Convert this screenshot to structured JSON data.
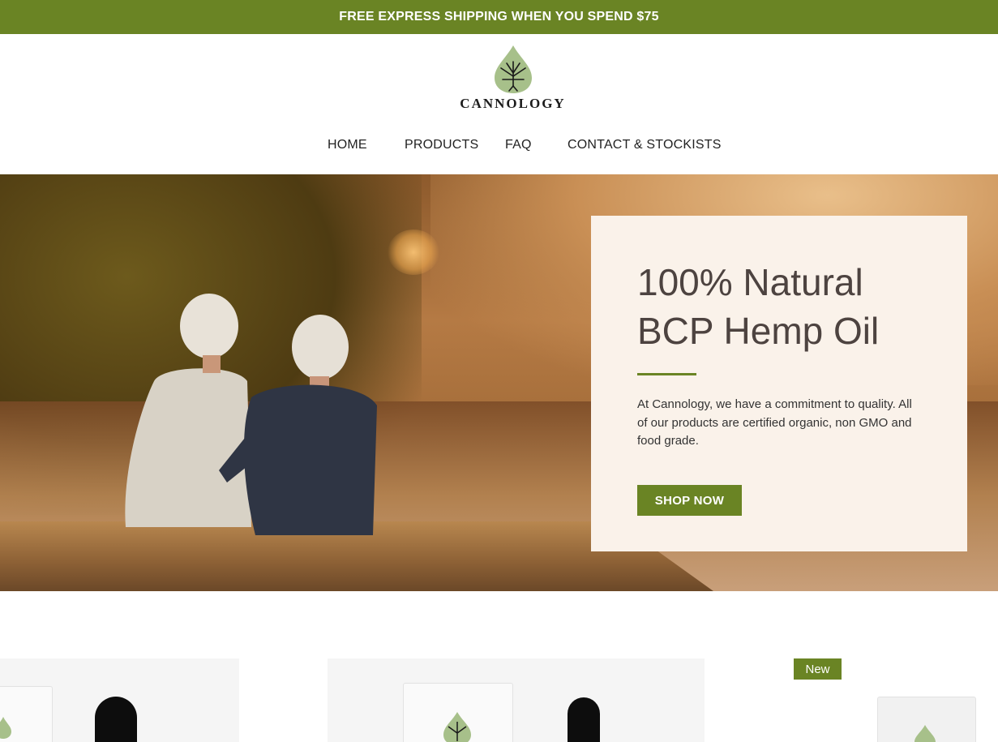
{
  "promo": {
    "text": "FREE EXPRESS SHIPPING WHEN YOU SPEND $75"
  },
  "header": {
    "brand": "CANNOLOGY",
    "nav": [
      "HOME",
      "PRODUCTS",
      "FAQ",
      "CONTACT & STOCKISTS"
    ]
  },
  "hero": {
    "title_line1": "100% Natural",
    "title_line2": "BCP Hemp Oil",
    "description": "At Cannology, we have a commitment to quality. All of our products are certified organic, non GMO and food grade.",
    "cta": "SHOP NOW"
  },
  "products": {
    "badge": "New"
  },
  "colors": {
    "brand_green": "#6a8424",
    "card_bg": "#faf2ea",
    "heading": "#4d4340"
  }
}
